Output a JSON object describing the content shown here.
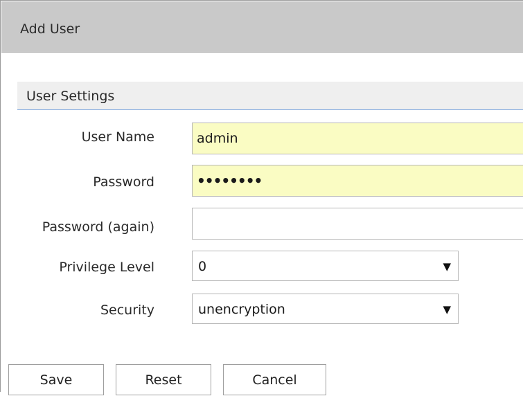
{
  "dialog": {
    "title": "Add User"
  },
  "section": {
    "title": "User Settings"
  },
  "form": {
    "user_name": {
      "label": "User Name",
      "value": "admin"
    },
    "password": {
      "label": "Password",
      "value": "••••••••"
    },
    "password_again": {
      "label": "Password (again)",
      "value": ""
    },
    "privilege_level": {
      "label": "Privilege Level",
      "value": "0"
    },
    "security": {
      "label": "Security",
      "value": "unencryption"
    }
  },
  "buttons": {
    "save": "Save",
    "reset": "Reset",
    "cancel": "Cancel"
  },
  "colors": {
    "title_bar": "#c9c9c9",
    "section_bar": "#efefef",
    "section_underline": "#88aee0",
    "autofill_yellow": "#fafcc3"
  },
  "icons": {
    "dropdown": "dropdown-arrow-icon"
  }
}
